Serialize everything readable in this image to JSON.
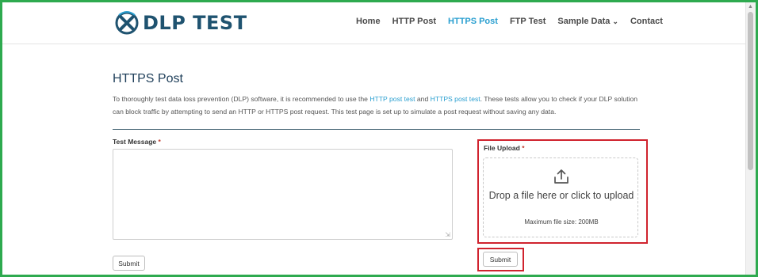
{
  "brand": {
    "logo_text": "DLP TEST"
  },
  "nav": {
    "items": [
      {
        "label": "Home"
      },
      {
        "label": "HTTP Post"
      },
      {
        "label": "HTTPS Post"
      },
      {
        "label": "FTP Test"
      },
      {
        "label": "Sample Data"
      },
      {
        "label": "Contact"
      }
    ],
    "active": "HTTPS Post",
    "dropdown_icon": "chevron-down-icon"
  },
  "page": {
    "title": "HTTPS Post",
    "intro": {
      "part1": "To thoroughly test data loss prevention (DLP) software, it is recommended to use the ",
      "link1": "HTTP post test",
      "part2": " and ",
      "link2": "HTTPS post test",
      "part3": ". These tests allow you to check if your DLP solution can block traffic by attempting to send an HTTP or HTTPS post request. This test page is set up to simulate a post request without saving any data."
    }
  },
  "form": {
    "message_label": "Test Message",
    "required_mark": "*",
    "message_value": "",
    "submit_label": "Submit"
  },
  "upload": {
    "label": "File Upload",
    "required_mark": "*",
    "icon": "upload-icon",
    "drop_text": "Drop a file here or click to upload",
    "max_size": "Maximum file size: 200MB",
    "submit_label": "Submit"
  },
  "colors": {
    "brand": "#1f5370",
    "link": "#2a9fd0",
    "highlight": "#d0232e",
    "outer_border": "#2eaa4f"
  }
}
